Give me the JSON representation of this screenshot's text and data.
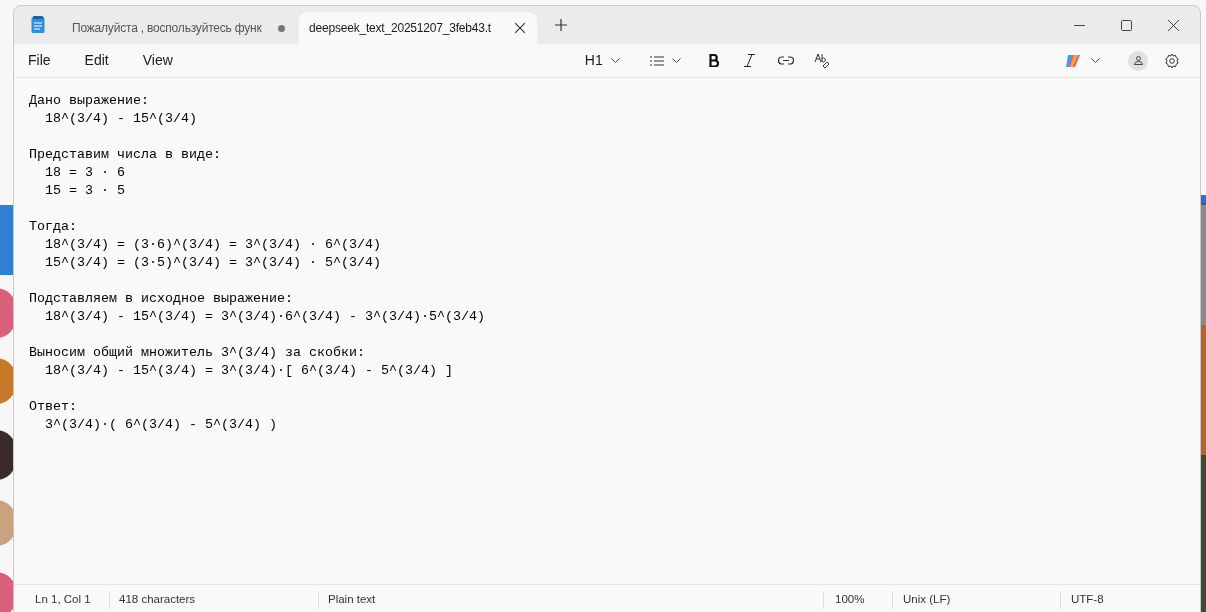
{
  "tabs": [
    {
      "label": "Пожалуйста , воспользуйтесь функ",
      "selected": false,
      "unsaved": true
    },
    {
      "label": "deepseek_text_20251207_3feb43.t",
      "selected": true,
      "unsaved": false
    }
  ],
  "menu": [
    "File",
    "Edit",
    "View"
  ],
  "toolbar": {
    "heading": "H1"
  },
  "editor": {
    "blocks": [
      {
        "heading": "Дано выражение:",
        "lines": [
          "18^(3/4) - 15^(3/4)"
        ]
      },
      {
        "heading": "Представим числа в виде:",
        "lines": [
          "18 = 3 · 6",
          "15 = 3 · 5"
        ]
      },
      {
        "heading": "Тогда:",
        "lines": [
          "18^(3/4) = (3·6)^(3/4) = 3^(3/4) · 6^(3/4)",
          "15^(3/4) = (3·5)^(3/4) = 3^(3/4) · 5^(3/4)"
        ]
      },
      {
        "heading": "Подставляем в исходное выражение:",
        "lines": [
          "18^(3/4) - 15^(3/4) = 3^(3/4)·6^(3/4) - 3^(3/4)·5^(3/4)"
        ]
      },
      {
        "heading": "Выносим общий множитель 3^(3/4) за скобки:",
        "lines": [
          "18^(3/4) - 15^(3/4) = 3^(3/4)·[ 6^(3/4) - 5^(3/4) ]"
        ]
      },
      {
        "heading": "Ответ:",
        "lines": [
          "3^(3/4)·( 6^(3/4) - 5^(3/4) )"
        ]
      }
    ]
  },
  "status_bar": {
    "position": "Ln 1, Col 1",
    "characters": "418 characters",
    "format": "Plain text",
    "zoom": "100%",
    "line_ending": "Unix (LF)",
    "encoding": "UTF-8"
  }
}
